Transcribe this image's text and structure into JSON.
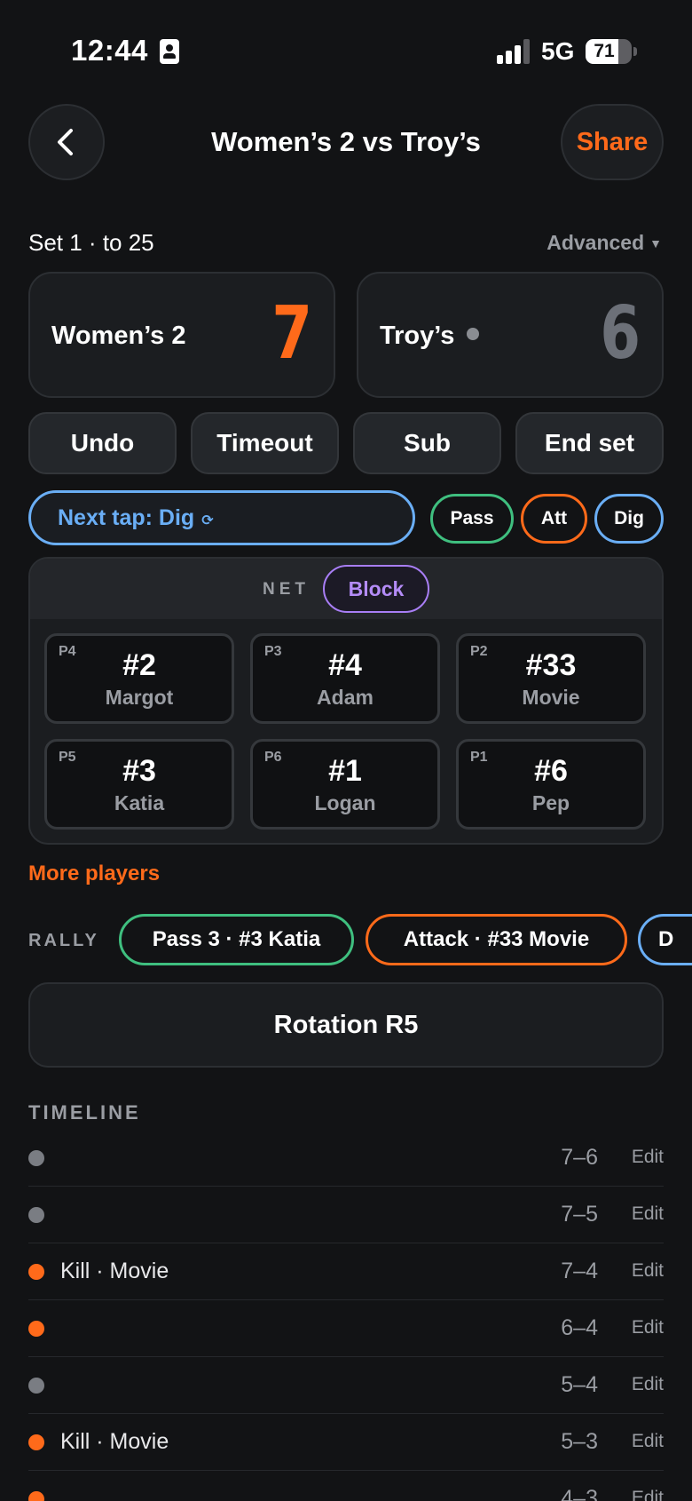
{
  "status": {
    "time": "12:44",
    "network": "5G",
    "battery": "71",
    "battery_fraction": 0.71
  },
  "header": {
    "title": "Women’s 2 vs Troy’s",
    "share_label": "Share"
  },
  "set": {
    "label": "Set 1 · to 25",
    "advanced_label": "Advanced"
  },
  "teams": [
    {
      "name": "Women’s 2",
      "score": "7",
      "color": "#ff6a1a",
      "serving": false
    },
    {
      "name": "Troy’s",
      "score": "6",
      "color": "#6c7078",
      "serving": true
    }
  ],
  "actions": [
    "Undo",
    "Timeout",
    "Sub",
    "End set"
  ],
  "next_tap": {
    "label": "Next tap: Dig",
    "color": "#6aaef5"
  },
  "tap_types": [
    {
      "label": "Pass",
      "color": "#3fbf7f"
    },
    {
      "label": "Att",
      "color": "#ff6a1a"
    },
    {
      "label": "Dig",
      "color": "#6aaef5"
    }
  ],
  "court": {
    "net_label": "NET",
    "block_label": "Block",
    "players": [
      {
        "pos": "P4",
        "number": "#2",
        "name": "Margot"
      },
      {
        "pos": "P3",
        "number": "#4",
        "name": "Adam"
      },
      {
        "pos": "P2",
        "number": "#33",
        "name": "Movie"
      },
      {
        "pos": "P5",
        "number": "#3",
        "name": "Katia"
      },
      {
        "pos": "P6",
        "number": "#1",
        "name": "Logan"
      },
      {
        "pos": "P1",
        "number": "#6",
        "name": "Pep"
      }
    ]
  },
  "more_players_label": "More players",
  "rally": {
    "label": "RALLY",
    "chips": [
      {
        "label": "Pass 3 · #3 Katia",
        "color": "#3fbf7f"
      },
      {
        "label": "Attack · #33 Movie",
        "color": "#ff6a1a"
      },
      {
        "label": "D",
        "color": "#6aaef5"
      }
    ]
  },
  "rotation_label": "Rotation R5",
  "timeline": {
    "label": "TIMELINE",
    "edit_label": "Edit",
    "rows": [
      {
        "text": "",
        "score": "7–6",
        "color": "#7a7d83"
      },
      {
        "text": "",
        "score": "7–5",
        "color": "#7a7d83"
      },
      {
        "text": "Kill · Movie",
        "score": "7–4",
        "color": "#ff6a1a"
      },
      {
        "text": "",
        "score": "6–4",
        "color": "#ff6a1a"
      },
      {
        "text": "",
        "score": "5–4",
        "color": "#7a7d83"
      },
      {
        "text": "Kill · Movie",
        "score": "5–3",
        "color": "#ff6a1a"
      },
      {
        "text": "",
        "score": "4–3",
        "color": "#ff6a1a"
      }
    ]
  }
}
